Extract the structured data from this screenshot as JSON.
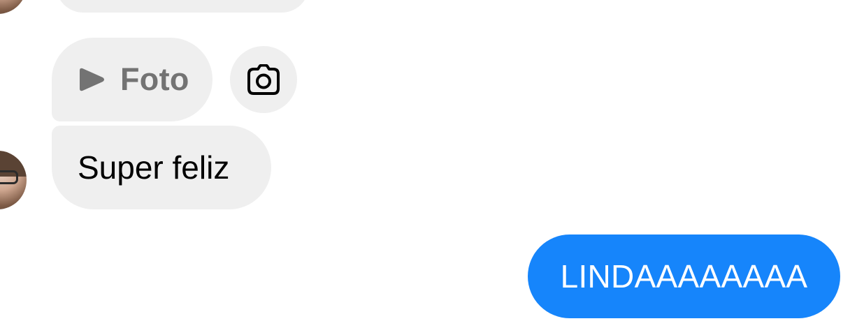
{
  "conversation": {
    "messages": [
      {
        "type": "photo",
        "label": "Foto",
        "icon": "play-icon",
        "action_icon": "camera-icon"
      },
      {
        "type": "text",
        "sender": "other",
        "text": "Super feliz"
      },
      {
        "type": "text",
        "sender": "self",
        "text": "LINDAAAAAAAA"
      }
    ]
  },
  "colors": {
    "received_bubble": "#efefef",
    "sent_bubble": "#1685fb",
    "photo_label": "#737373"
  }
}
